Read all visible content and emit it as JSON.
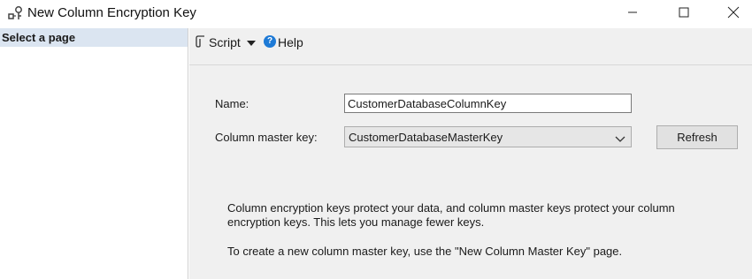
{
  "window": {
    "title": "New Column Encryption Key",
    "icon": "key-icon",
    "controls": [
      "minimize-icon",
      "maximize-icon",
      "close-icon"
    ]
  },
  "left_pane": {
    "header": "Select a page"
  },
  "toolbar": {
    "script_label": "Script",
    "help_label": "Help",
    "help_glyph": "?"
  },
  "form": {
    "name_label": "Name:",
    "name_value": "CustomerDatabaseColumnKey",
    "cmk_label": "Column master key:",
    "cmk_value": "CustomerDatabaseMasterKey",
    "refresh_label": "Refresh"
  },
  "description": {
    "paragraph1": "Column encryption keys protect your data, and column master keys protect your column encryption keys. This lets you manage fewer keys.",
    "paragraph2": "To create a new column master key, use the \"New Column Master Key\" page."
  },
  "colors": {
    "page_header_bg": "#dbe5f1",
    "pane_bg": "#f0f0f0",
    "help_icon": "#1e7ad6"
  }
}
